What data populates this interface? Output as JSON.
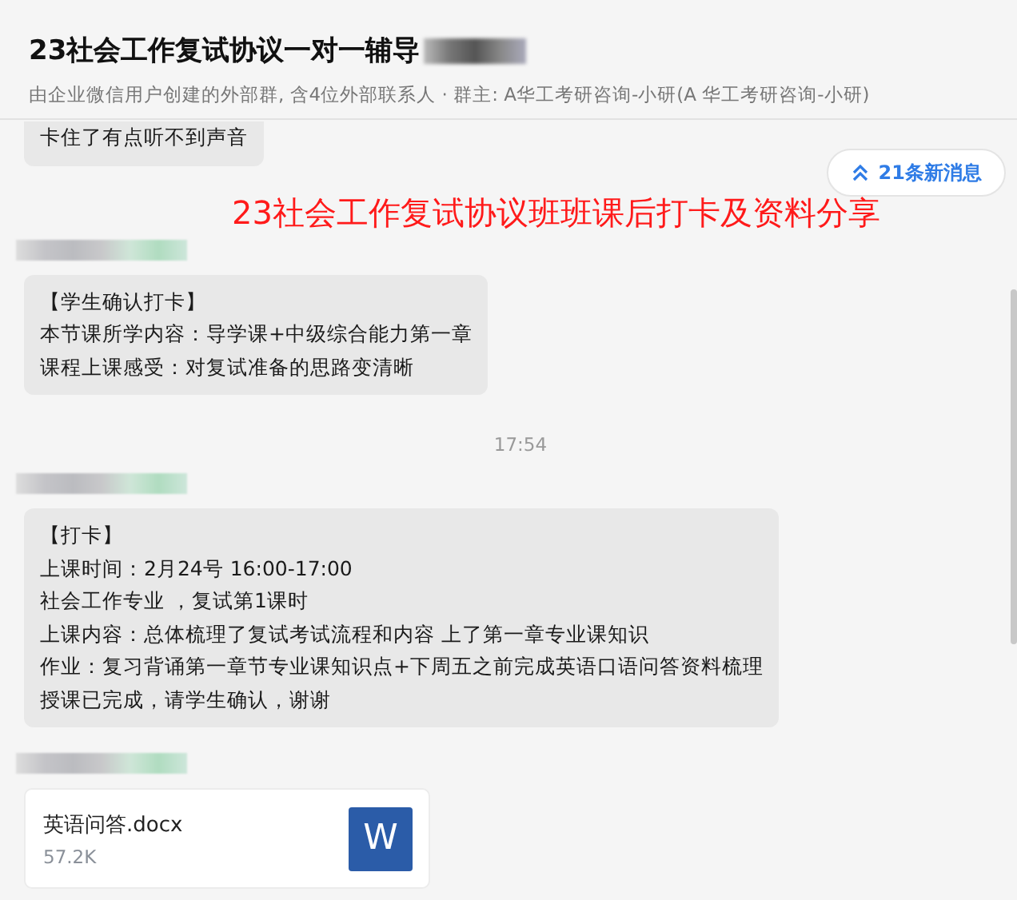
{
  "header": {
    "title": "23社会工作复试协议一对一辅导",
    "subtitle": "由企业微信用户创建的外部群, 含4位外部联系人 · 群主: A华工考研咨询-小研(A 华工考研咨询-小研)"
  },
  "overlay_caption": "23社会工作复试协议班班课后打卡及资料分享",
  "new_messages": {
    "label": "21条新消息"
  },
  "messages": [
    {
      "kind": "text",
      "sender_shown": false,
      "lines": [
        "卡住了有点听不到声音"
      ]
    },
    {
      "kind": "text",
      "sender_shown": true,
      "lines": [
        "【学生确认打卡】",
        "本节课所学内容：导学课+中级综合能力第一章",
        "课程上课感受：对复试准备的思路变清晰"
      ]
    },
    {
      "kind": "time",
      "text": "17:54"
    },
    {
      "kind": "text",
      "sender_shown": true,
      "lines": [
        "【打卡】",
        "上课时间：2月24号 16:00-17:00",
        "社会工作专业 ，复试第1课时",
        "上课内容：总体梳理了复试考试流程和内容 上了第一章专业课知识",
        "作业：复习背诵第一章节专业课知识点+下周五之前完成英语口语问答资料梳理",
        "授课已完成，请学生确认，谢谢"
      ]
    },
    {
      "kind": "file",
      "sender_shown": true,
      "name": "英语问答.docx",
      "size": "57.2K",
      "icon_letter": "W"
    }
  ]
}
